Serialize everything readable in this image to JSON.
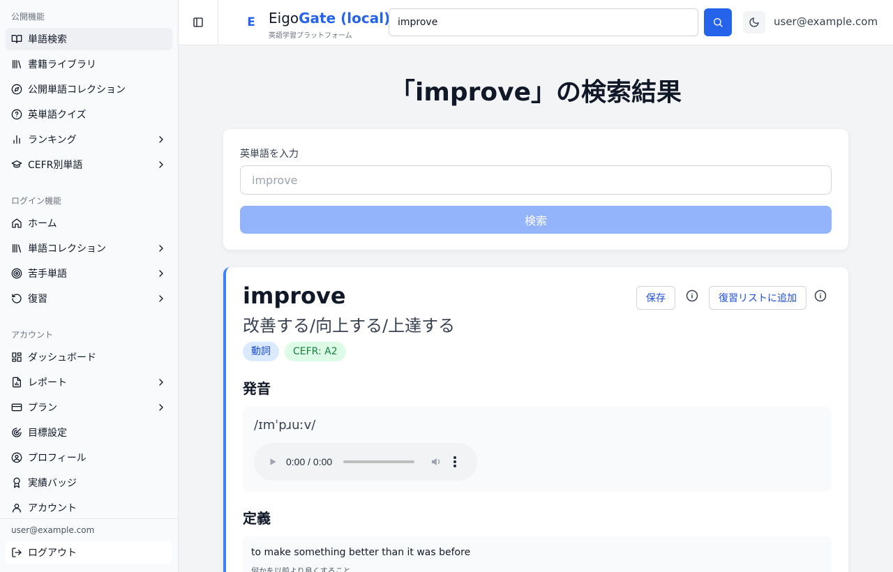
{
  "sidebar": {
    "section_public": "公開機能",
    "section_login": "ログイン機能",
    "section_account": "アカウント",
    "public_items": [
      {
        "label": "単語検索"
      },
      {
        "label": "書籍ライブラリ"
      },
      {
        "label": "公開単語コレクション"
      },
      {
        "label": "英単語クイズ"
      },
      {
        "label": "ランキング"
      },
      {
        "label": "CEFR別単語"
      }
    ],
    "login_items": [
      {
        "label": "ホーム"
      },
      {
        "label": "単語コレクション"
      },
      {
        "label": "苦手単語"
      },
      {
        "label": "復習"
      }
    ],
    "account_items": [
      {
        "label": "ダッシュボード"
      },
      {
        "label": "レポート"
      },
      {
        "label": "プラン"
      },
      {
        "label": "目標設定"
      },
      {
        "label": "プロフィール"
      },
      {
        "label": "実績バッジ"
      },
      {
        "label": "アカウント"
      }
    ],
    "footer_email": "user@example.com",
    "logout_label": "ログアウト"
  },
  "header": {
    "logo_letter": "E",
    "brand_part1": "Eigo",
    "brand_part2": "Gate (local)",
    "tagline": "英語学習プラットフォーム",
    "search_value": "improve",
    "user_email": "user@example.com"
  },
  "main": {
    "page_title": "「improve」の検索結果",
    "search_card": {
      "field_label": "英単語を入力",
      "input_placeholder": "improve",
      "button_label": "検索"
    },
    "result": {
      "word": "improve",
      "meaning": "改善する/向上する/上達する",
      "pos_badge": "動詞",
      "cefr_badge": "CEFR: A2",
      "save_label": "保存",
      "review_label": "復習リストに追加",
      "pronunciation_heading": "発音",
      "ipa": "/ɪmˈpɹuːv/",
      "audio_time": "0:00 / 0:00",
      "definition_heading": "定義",
      "definition_en": "to make something better than it was before",
      "definition_ja": "何かを以前より良くすること"
    }
  },
  "colors": {
    "accent": "#2563eb",
    "disabled_button": "#93b4fb",
    "pos_badge_bg": "#dbeafe",
    "cefr_badge_bg": "#dcfce7"
  }
}
